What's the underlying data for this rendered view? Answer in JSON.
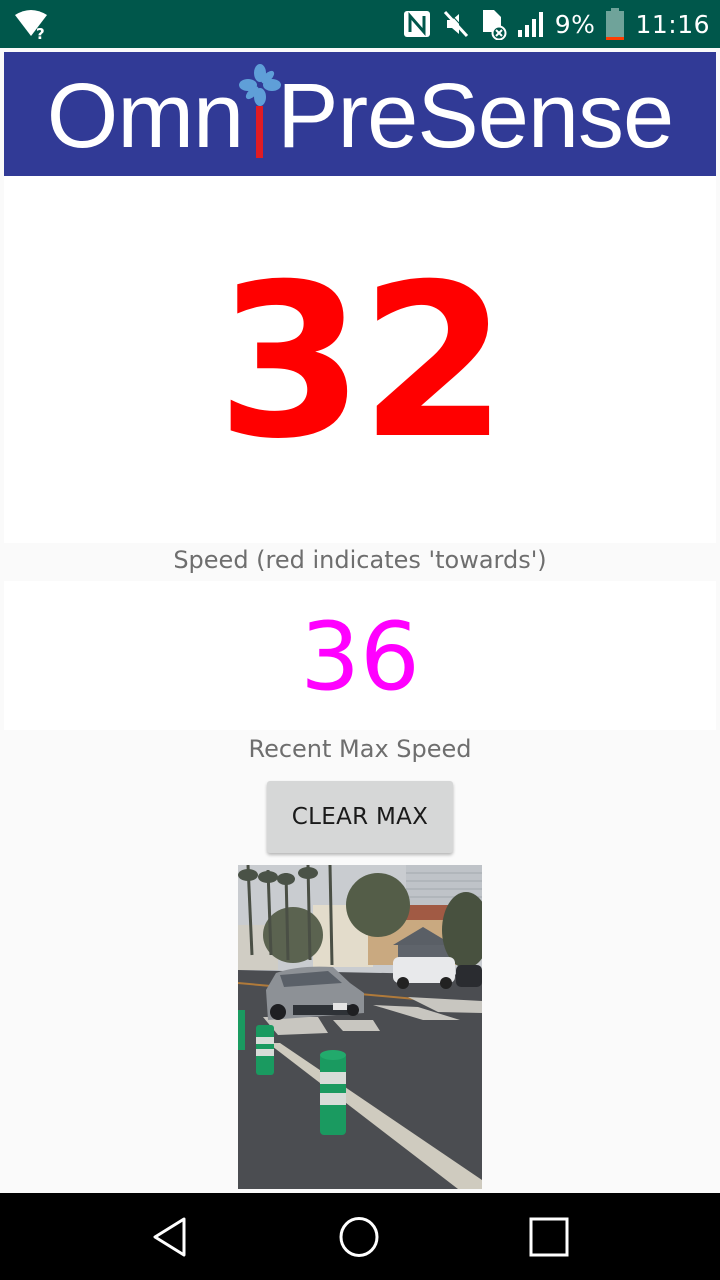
{
  "status_bar": {
    "time": "11:16",
    "battery_percent": "9%",
    "battery_level": 0.09,
    "icons": [
      "wifi-no-internet-icon",
      "nfc-icon",
      "mute-icon",
      "sim-error-icon",
      "signal-icon",
      "battery-icon"
    ]
  },
  "banner": {
    "logo_part1": "Omn",
    "logo_part2": "PreSense",
    "brand_color": "#313a96"
  },
  "speed": {
    "value": "32",
    "color": "#ff0000",
    "caption": "Speed (red indicates 'towards')"
  },
  "max_speed": {
    "value": "36",
    "color": "#ff00ff",
    "caption": "Recent Max Speed"
  },
  "clear_button": {
    "label": "CLEAR MAX"
  },
  "camera": {
    "description": "Live camera preview of street with gray sedan approaching and green bollards"
  },
  "nav_bar": {
    "buttons": [
      "back",
      "home",
      "recents"
    ]
  }
}
